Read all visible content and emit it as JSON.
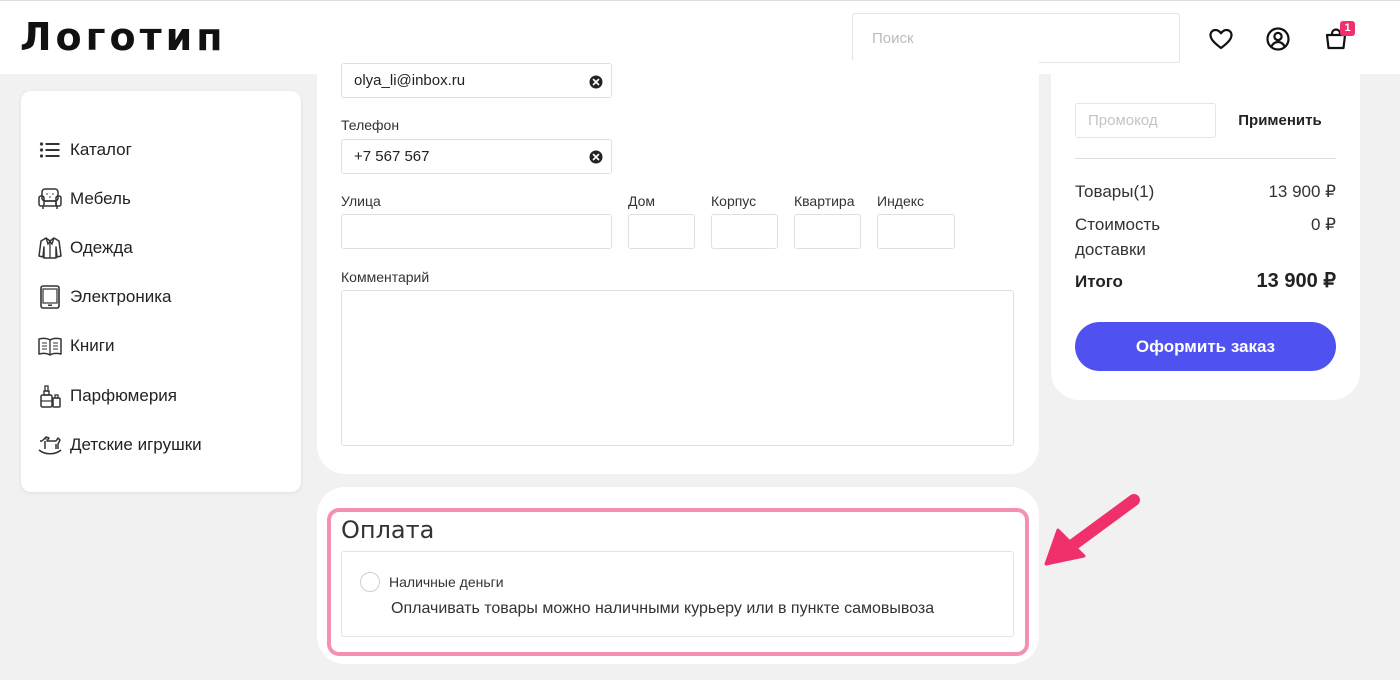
{
  "header": {
    "logo": "Логотип",
    "search_placeholder": "Поиск",
    "cart_count": "1"
  },
  "sidebar": {
    "items": [
      {
        "label": "Каталог",
        "icon": "list-icon"
      },
      {
        "label": "Мебель",
        "icon": "armchair-icon"
      },
      {
        "label": "Одежда",
        "icon": "jacket-icon"
      },
      {
        "label": "Электроника",
        "icon": "tablet-icon"
      },
      {
        "label": "Книги",
        "icon": "book-icon"
      },
      {
        "label": "Парфюмерия",
        "icon": "perfume-icon"
      },
      {
        "label": "Детские игрушки",
        "icon": "rocking-horse-icon"
      }
    ]
  },
  "form": {
    "email_value": "olya_li@inbox.ru",
    "phone_label": "Телефон",
    "phone_value": "+7 567 567",
    "street_label": "Улица",
    "house_label": "Дом",
    "building_label": "Корпус",
    "apartment_label": "Квартира",
    "index_label": "Индекс",
    "comment_label": "Комментарий"
  },
  "payment": {
    "title": "Оплата",
    "option_label": "Наличные деньги",
    "option_description": "Оплачивать товары можно наличными курьеру или в пункте самовывоза"
  },
  "summary": {
    "promo_placeholder": "Промокод",
    "apply_label": "Применить",
    "goods_label": "Товары(1)",
    "goods_value": "13 900 ₽",
    "delivery_label_line1": "Стоимость",
    "delivery_label_line2": "доставки",
    "delivery_value": "0 ₽",
    "total_label": "Итого",
    "total_value": "13 900 ₽",
    "order_button": "Оформить заказ"
  },
  "colors": {
    "accent": "#4f52f0",
    "highlight": "#f590ae",
    "arrow": "#f0306a",
    "badge": "#f0306a",
    "background": "#f2f1f1"
  }
}
